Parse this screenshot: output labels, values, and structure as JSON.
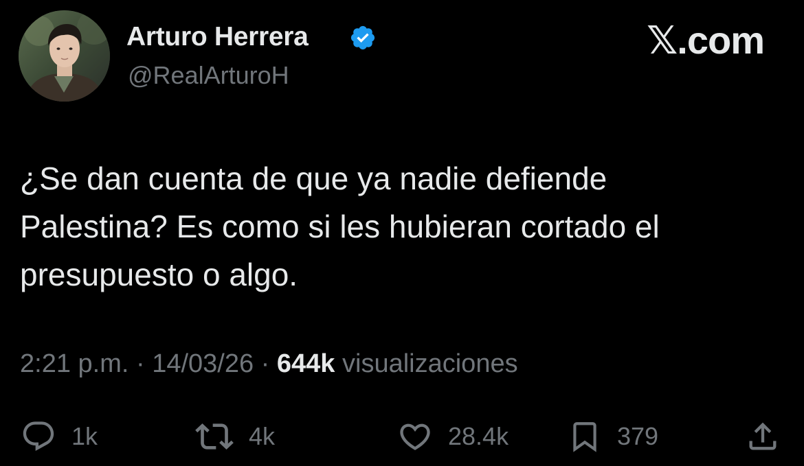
{
  "author": {
    "display_name": "Arturo Herrera",
    "handle": "@RealArturoH",
    "verified": true,
    "verified_color": "#1d9bf0"
  },
  "brand": "𝕏.com",
  "tweet": {
    "text": "¿Se dan cuenta de que ya nadie defiende\nPalestina? Es como si les hubieran cortado el\npresupuesto o algo."
  },
  "meta": {
    "time": "2:21 p.m.",
    "sep1": " · ",
    "date": "14/03/26",
    "sep2": " · ",
    "views_count": "644k",
    "views_label": " visualizaciones"
  },
  "actions": {
    "replies": {
      "icon": "reply-icon",
      "count": "1k"
    },
    "retweets": {
      "icon": "retweet-icon",
      "count": "4k"
    },
    "likes": {
      "icon": "heart-icon",
      "count": "28.4k"
    },
    "bookmarks": {
      "icon": "bookmark-icon",
      "count": "379"
    },
    "share": {
      "icon": "share-icon"
    }
  },
  "colors": {
    "background": "#000000",
    "primary_text": "#e7e9ea",
    "secondary_text": "#71767b"
  }
}
